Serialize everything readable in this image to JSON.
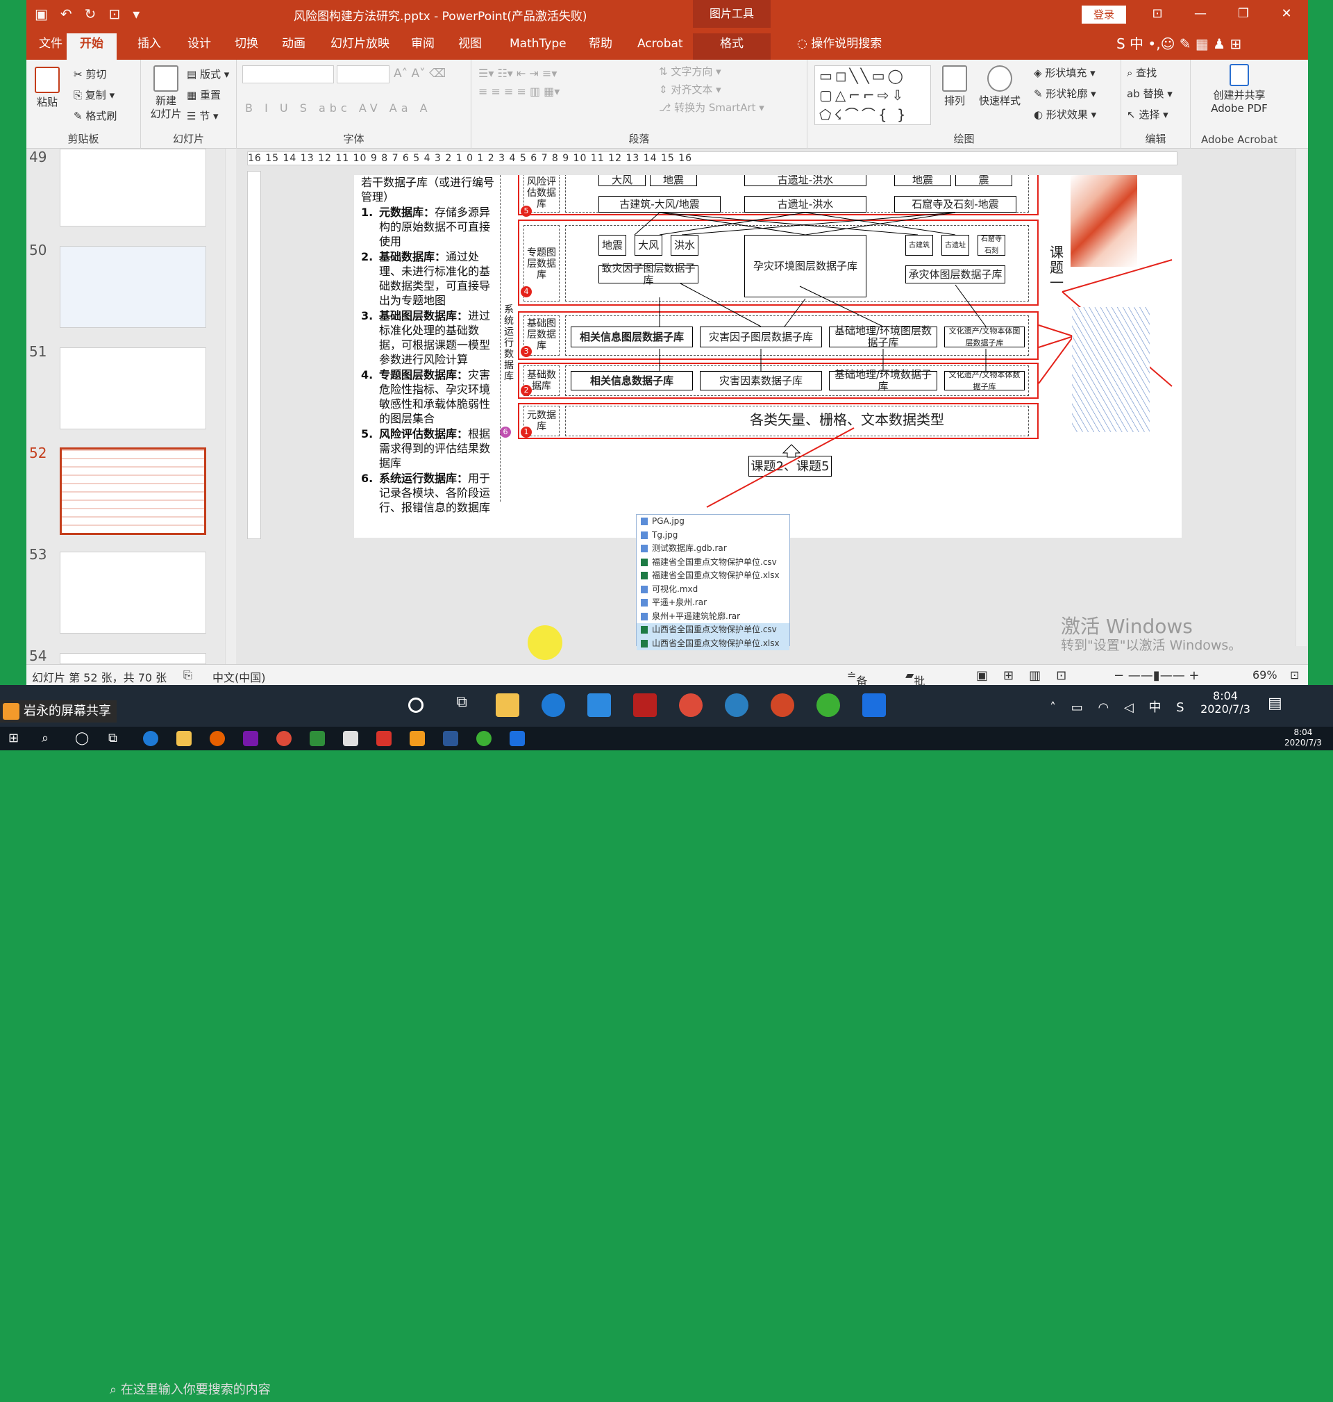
{
  "titlebar": {
    "doc_title": "风险图构建方法研究.pptx  -  PowerPoint(产品激活失败)",
    "context_tools": "图片工具",
    "login": "登录"
  },
  "tabs": [
    "文件",
    "开始",
    "插入",
    "设计",
    "切换",
    "动画",
    "幻灯片放映",
    "审阅",
    "视图",
    "MathType",
    "帮助",
    "Acrobat",
    "格式"
  ],
  "tell_me": "操作说明搜索",
  "ribbon": {
    "clipboard": {
      "paste": "粘贴",
      "cut": "剪切",
      "copy": "复制",
      "format_painter": "格式刷",
      "label": "剪贴板"
    },
    "slides": {
      "new_slide": "新建\n幻灯片",
      "layout": "版式",
      "reset": "重置",
      "section": "节",
      "label": "幻灯片"
    },
    "font": {
      "label": "字体",
      "bold": "B",
      "italic": "I",
      "underline": "U",
      "shadow": "S",
      "strike": "abc",
      "spacing": "AV",
      "case": "Aa",
      "color": "A"
    },
    "paragraph": {
      "label": "段落",
      "text_direction": "文字方向",
      "align_text": "对齐文本",
      "convert_smartart": "转换为 SmartArt"
    },
    "drawing": {
      "label": "绘图",
      "arrange": "排列",
      "quick_styles": "快速样式",
      "shape_fill": "形状填充",
      "shape_outline": "形状轮廓",
      "shape_effects": "形状效果"
    },
    "editing": {
      "label": "编辑",
      "find": "查找",
      "replace": "替换",
      "select": "选择"
    },
    "acrobat": {
      "create_share": "创建并共享\nAdobe PDF",
      "label": "Adobe Acrobat"
    }
  },
  "thumbnails": [
    {
      "num": "49"
    },
    {
      "num": "50"
    },
    {
      "num": "51"
    },
    {
      "num": "52",
      "active": true
    },
    {
      "num": "53"
    },
    {
      "num": "54"
    }
  ],
  "ruler_text": "16 15 14 13 12 11 10  9  8  7  6  5  4  3  2  1  0  1  2  3  4  5  6  7  8  9 10 11 12 13 14 15 16",
  "slide": {
    "intro": "若干数据子库（或进行编号管理）",
    "items": [
      {
        "num": "1.",
        "title": "元数据库：",
        "text": "存储多源异构的原始数据不可直接使用"
      },
      {
        "num": "2.",
        "title": "基础数据库：",
        "text": "通过处理、未进行标准化的基础数据类型，可直接导出为专题地图"
      },
      {
        "num": "3.",
        "title": "基础图层数据库：",
        "text": "进过标准化处理的基础数据，可根据课题一模型参数进行风险计算"
      },
      {
        "num": "4.",
        "title": "专题图层数据库：",
        "text": "灾害危险性指标、孕灾环境敏感性和承载体脆弱性的图层集合"
      },
      {
        "num": "5.",
        "title": "风险评估数据库：",
        "text": "根据需求得到的评估结果数据库"
      },
      {
        "num": "6.",
        "title": "系统运行数据库：",
        "text": "用于记录各模块、各阶段运行、报错信息的数据库"
      }
    ],
    "sys_label": "系统运行数据库",
    "rows": {
      "risk": {
        "label": "风险评估数据库",
        "top_boxes": [
          "大风",
          "地震",
          "古遗址-洪水",
          "地震",
          "震"
        ],
        "boxes": [
          "古建筑-大风/地震",
          "古遗址-洪水",
          "石窟寺及石刻-地震"
        ],
        "badge": "5"
      },
      "thematic": {
        "label": "专题图层数据库",
        "small": [
          "地震",
          "大风",
          "洪水",
          "古建筑",
          "古遗址",
          "石窟寺石刻"
        ],
        "factor": "致灾因子图层数据子库",
        "env": "孕灾环境图层数据子库",
        "carrier": "承灾体图层数据子库",
        "badge": "4"
      },
      "basic_layer": {
        "label": "基础图层数据库",
        "boxes": [
          "相关信息图层数据子库",
          "灾害因子图层数据子库",
          "基础地理/环境图层数据子库",
          "文化遗产/文物本体图层数据子库"
        ],
        "badge": "3"
      },
      "basic": {
        "label": "基础数据库",
        "boxes": [
          "相关信息数据子库",
          "灾害因素数据子库",
          "基础地理/环境数据子库",
          "文化遗产/文物本体数据子库"
        ],
        "badge": "2"
      },
      "meta": {
        "label": "元数据库",
        "content": "各类矢量、栅格、文本数据类型",
        "badge": "1"
      }
    },
    "badge6": "6",
    "topic_right": "课题一",
    "topic_bottom": "课题2、课题5",
    "files": [
      "PGA.jpg",
      "Tg.jpg",
      "测试数据库.gdb.rar",
      "福建省全国重点文物保护单位.csv",
      "福建省全国重点文物保护单位.xlsx",
      "可视化.mxd",
      "平遥+泉州.rar",
      "泉州+平遥建筑轮廓.rar",
      "山西省全国重点文物保护单位.csv",
      "山西省全国重点文物保护单位.xlsx"
    ]
  },
  "status": {
    "slide_info": "幻灯片 第 52 张，共 70 张",
    "language": "中文(中国)",
    "notes": "备注",
    "comments": "批注",
    "zoom": "69%"
  },
  "watermark": {
    "line1": "激活 Windows",
    "line2": "转到\"设置\"以激活 Windows。"
  },
  "taskbar": {
    "share_name": "岩永的屏幕共享",
    "search_placeholder": "在这里输入你要搜索的内容",
    "time": "8:04",
    "date": "2020/7/3",
    "ime": "中",
    "time2": "8:04",
    "date2": "2020/7/3"
  },
  "colors": {
    "accent": "#c43e1c",
    "red_box": "#e4231b",
    "desktop": "#1a9b4b"
  }
}
